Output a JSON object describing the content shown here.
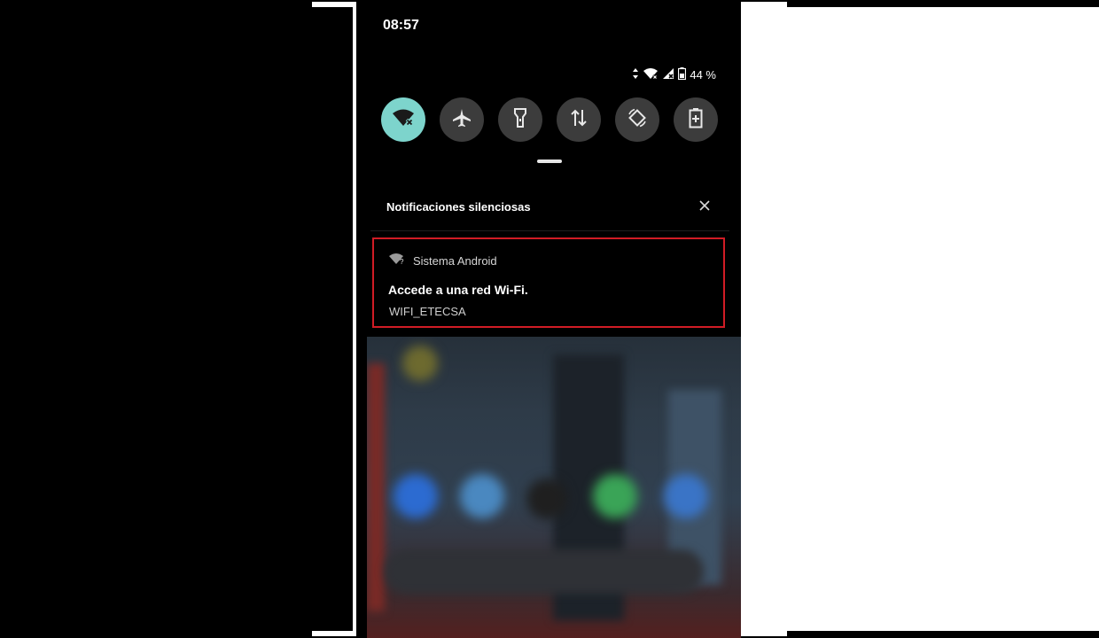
{
  "status_bar": {
    "time": "08:57",
    "battery_percent": "44 %",
    "icons": [
      "data-arrows-icon",
      "wifi-no-internet-icon",
      "signal-no-service-icon",
      "battery-icon"
    ]
  },
  "quick_settings": {
    "tiles": [
      {
        "name": "wifi",
        "icon": "wifi-off-icon",
        "active": true
      },
      {
        "name": "airplane",
        "icon": "airplane-icon",
        "active": false
      },
      {
        "name": "flashlight",
        "icon": "flashlight-icon",
        "active": false
      },
      {
        "name": "mobile-data",
        "icon": "data-transfer-icon",
        "active": false
      },
      {
        "name": "auto-rotate",
        "icon": "rotate-icon",
        "active": false
      },
      {
        "name": "battery-saver",
        "icon": "battery-saver-icon",
        "active": false
      }
    ],
    "active_color": "#7dd4cc"
  },
  "notifications": {
    "section_title": "Notificaciones silenciosas",
    "items": [
      {
        "app_name": "Sistema Android",
        "app_icon": "wifi-question-icon",
        "title": "Accede a una red Wi-Fi.",
        "text": "WIFI_ETECSA",
        "highlight_color": "#d11c25"
      }
    ]
  }
}
